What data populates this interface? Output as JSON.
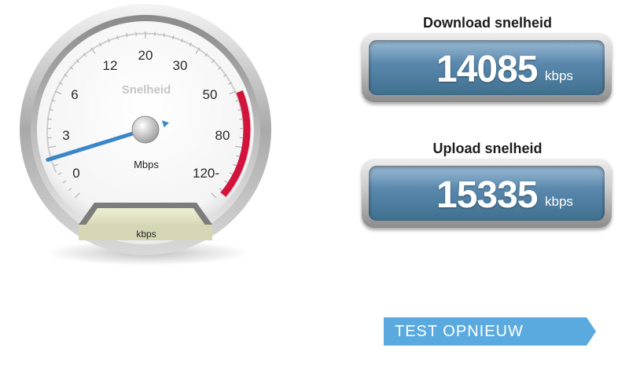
{
  "gauge": {
    "title": "Snelheid",
    "unit": "Mbps",
    "bottom_unit": "kbps",
    "scale_labels": [
      "0",
      "3",
      "6",
      "12",
      "20",
      "30",
      "50",
      "80",
      "120-"
    ],
    "needle_scale_position": 0.1,
    "colors": {
      "needle": "#3b86c8",
      "red_zone": "#d2143c"
    }
  },
  "download": {
    "label": "Download snelheid",
    "value": "14085",
    "unit": "kbps"
  },
  "upload": {
    "label": "Upload snelheid",
    "value": "15335",
    "unit": "kbps"
  },
  "actions": {
    "retest_label": "TEST OPNIEUW",
    "retest_color": "#5aaae0"
  }
}
